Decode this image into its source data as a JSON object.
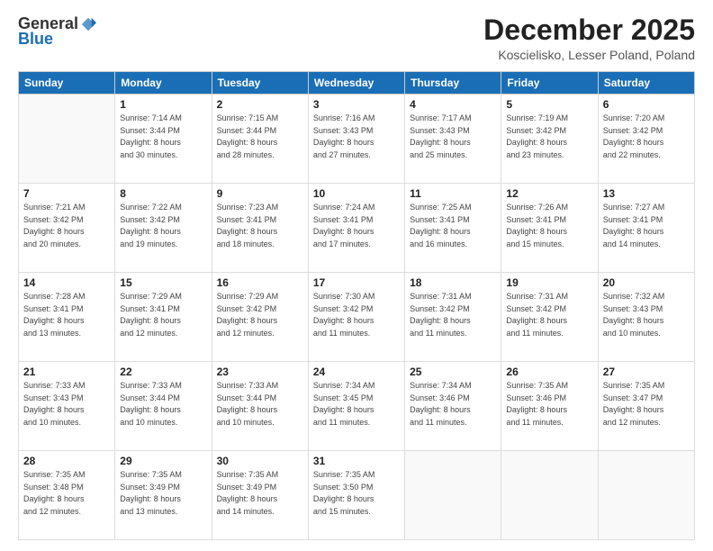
{
  "logo": {
    "general": "General",
    "blue": "Blue"
  },
  "title": "December 2025",
  "location": "Koscielisko, Lesser Poland, Poland",
  "days_header": [
    "Sunday",
    "Monday",
    "Tuesday",
    "Wednesday",
    "Thursday",
    "Friday",
    "Saturday"
  ],
  "weeks": [
    [
      {
        "day": "",
        "info": ""
      },
      {
        "day": "1",
        "info": "Sunrise: 7:14 AM\nSunset: 3:44 PM\nDaylight: 8 hours\nand 30 minutes."
      },
      {
        "day": "2",
        "info": "Sunrise: 7:15 AM\nSunset: 3:44 PM\nDaylight: 8 hours\nand 28 minutes."
      },
      {
        "day": "3",
        "info": "Sunrise: 7:16 AM\nSunset: 3:43 PM\nDaylight: 8 hours\nand 27 minutes."
      },
      {
        "day": "4",
        "info": "Sunrise: 7:17 AM\nSunset: 3:43 PM\nDaylight: 8 hours\nand 25 minutes."
      },
      {
        "day": "5",
        "info": "Sunrise: 7:19 AM\nSunset: 3:42 PM\nDaylight: 8 hours\nand 23 minutes."
      },
      {
        "day": "6",
        "info": "Sunrise: 7:20 AM\nSunset: 3:42 PM\nDaylight: 8 hours\nand 22 minutes."
      }
    ],
    [
      {
        "day": "7",
        "info": "Sunrise: 7:21 AM\nSunset: 3:42 PM\nDaylight: 8 hours\nand 20 minutes."
      },
      {
        "day": "8",
        "info": "Sunrise: 7:22 AM\nSunset: 3:42 PM\nDaylight: 8 hours\nand 19 minutes."
      },
      {
        "day": "9",
        "info": "Sunrise: 7:23 AM\nSunset: 3:41 PM\nDaylight: 8 hours\nand 18 minutes."
      },
      {
        "day": "10",
        "info": "Sunrise: 7:24 AM\nSunset: 3:41 PM\nDaylight: 8 hours\nand 17 minutes."
      },
      {
        "day": "11",
        "info": "Sunrise: 7:25 AM\nSunset: 3:41 PM\nDaylight: 8 hours\nand 16 minutes."
      },
      {
        "day": "12",
        "info": "Sunrise: 7:26 AM\nSunset: 3:41 PM\nDaylight: 8 hours\nand 15 minutes."
      },
      {
        "day": "13",
        "info": "Sunrise: 7:27 AM\nSunset: 3:41 PM\nDaylight: 8 hours\nand 14 minutes."
      }
    ],
    [
      {
        "day": "14",
        "info": "Sunrise: 7:28 AM\nSunset: 3:41 PM\nDaylight: 8 hours\nand 13 minutes."
      },
      {
        "day": "15",
        "info": "Sunrise: 7:29 AM\nSunset: 3:41 PM\nDaylight: 8 hours\nand 12 minutes."
      },
      {
        "day": "16",
        "info": "Sunrise: 7:29 AM\nSunset: 3:42 PM\nDaylight: 8 hours\nand 12 minutes."
      },
      {
        "day": "17",
        "info": "Sunrise: 7:30 AM\nSunset: 3:42 PM\nDaylight: 8 hours\nand 11 minutes."
      },
      {
        "day": "18",
        "info": "Sunrise: 7:31 AM\nSunset: 3:42 PM\nDaylight: 8 hours\nand 11 minutes."
      },
      {
        "day": "19",
        "info": "Sunrise: 7:31 AM\nSunset: 3:42 PM\nDaylight: 8 hours\nand 11 minutes."
      },
      {
        "day": "20",
        "info": "Sunrise: 7:32 AM\nSunset: 3:43 PM\nDaylight: 8 hours\nand 10 minutes."
      }
    ],
    [
      {
        "day": "21",
        "info": "Sunrise: 7:33 AM\nSunset: 3:43 PM\nDaylight: 8 hours\nand 10 minutes."
      },
      {
        "day": "22",
        "info": "Sunrise: 7:33 AM\nSunset: 3:44 PM\nDaylight: 8 hours\nand 10 minutes."
      },
      {
        "day": "23",
        "info": "Sunrise: 7:33 AM\nSunset: 3:44 PM\nDaylight: 8 hours\nand 10 minutes."
      },
      {
        "day": "24",
        "info": "Sunrise: 7:34 AM\nSunset: 3:45 PM\nDaylight: 8 hours\nand 11 minutes."
      },
      {
        "day": "25",
        "info": "Sunrise: 7:34 AM\nSunset: 3:46 PM\nDaylight: 8 hours\nand 11 minutes."
      },
      {
        "day": "26",
        "info": "Sunrise: 7:35 AM\nSunset: 3:46 PM\nDaylight: 8 hours\nand 11 minutes."
      },
      {
        "day": "27",
        "info": "Sunrise: 7:35 AM\nSunset: 3:47 PM\nDaylight: 8 hours\nand 12 minutes."
      }
    ],
    [
      {
        "day": "28",
        "info": "Sunrise: 7:35 AM\nSunset: 3:48 PM\nDaylight: 8 hours\nand 12 minutes."
      },
      {
        "day": "29",
        "info": "Sunrise: 7:35 AM\nSunset: 3:49 PM\nDaylight: 8 hours\nand 13 minutes."
      },
      {
        "day": "30",
        "info": "Sunrise: 7:35 AM\nSunset: 3:49 PM\nDaylight: 8 hours\nand 14 minutes."
      },
      {
        "day": "31",
        "info": "Sunrise: 7:35 AM\nSunset: 3:50 PM\nDaylight: 8 hours\nand 15 minutes."
      },
      {
        "day": "",
        "info": ""
      },
      {
        "day": "",
        "info": ""
      },
      {
        "day": "",
        "info": ""
      }
    ]
  ]
}
